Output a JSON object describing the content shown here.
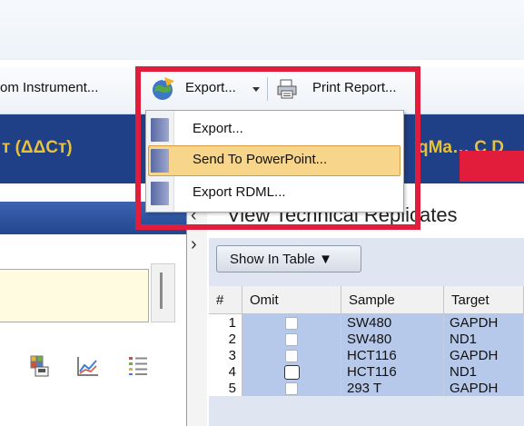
{
  "toolbar": {
    "from_instrument_label": "om Instrument...",
    "export_label": "Export...",
    "print_report_label": "Print Report..."
  },
  "header": {
    "method_label": "т (ΔΔCт)",
    "chemistry_label": "qMa… Ç D"
  },
  "export_menu": {
    "items": [
      {
        "label": "Export..."
      },
      {
        "label": "Send To PowerPoint...",
        "highlighted": true
      },
      {
        "label": "Export RDML..."
      }
    ]
  },
  "right_panel": {
    "title": "View Technical Replicates",
    "show_in_table_label": "Show In Table ▼",
    "columns": [
      "#",
      "Omit",
      "Sample",
      "Target"
    ],
    "rows": [
      {
        "num": "1",
        "sample": "SW480",
        "target": "GAPDH"
      },
      {
        "num": "2",
        "sample": "SW480",
        "target": "ND1"
      },
      {
        "num": "3",
        "sample": "HCT116",
        "target": "GAPDH"
      },
      {
        "num": "4",
        "sample": "HCT116",
        "target": "ND1"
      },
      {
        "num": "5",
        "sample": "293 T",
        "target": "GAPDH"
      }
    ]
  },
  "colors": {
    "accent_red": "#e21d3c",
    "header_blue": "#1f3f86",
    "header_text": "#e8c23a",
    "row_highlight": "#b7c9ea",
    "menu_highlight": "#f7d58b"
  },
  "icons": [
    "export-globe-icon",
    "print-icon",
    "dropdown-arrow-icon",
    "menu-bar-icon",
    "grid-view-icon",
    "line-chart-icon",
    "list-icon",
    "chevron-left-icon",
    "chevron-right-icon"
  ]
}
